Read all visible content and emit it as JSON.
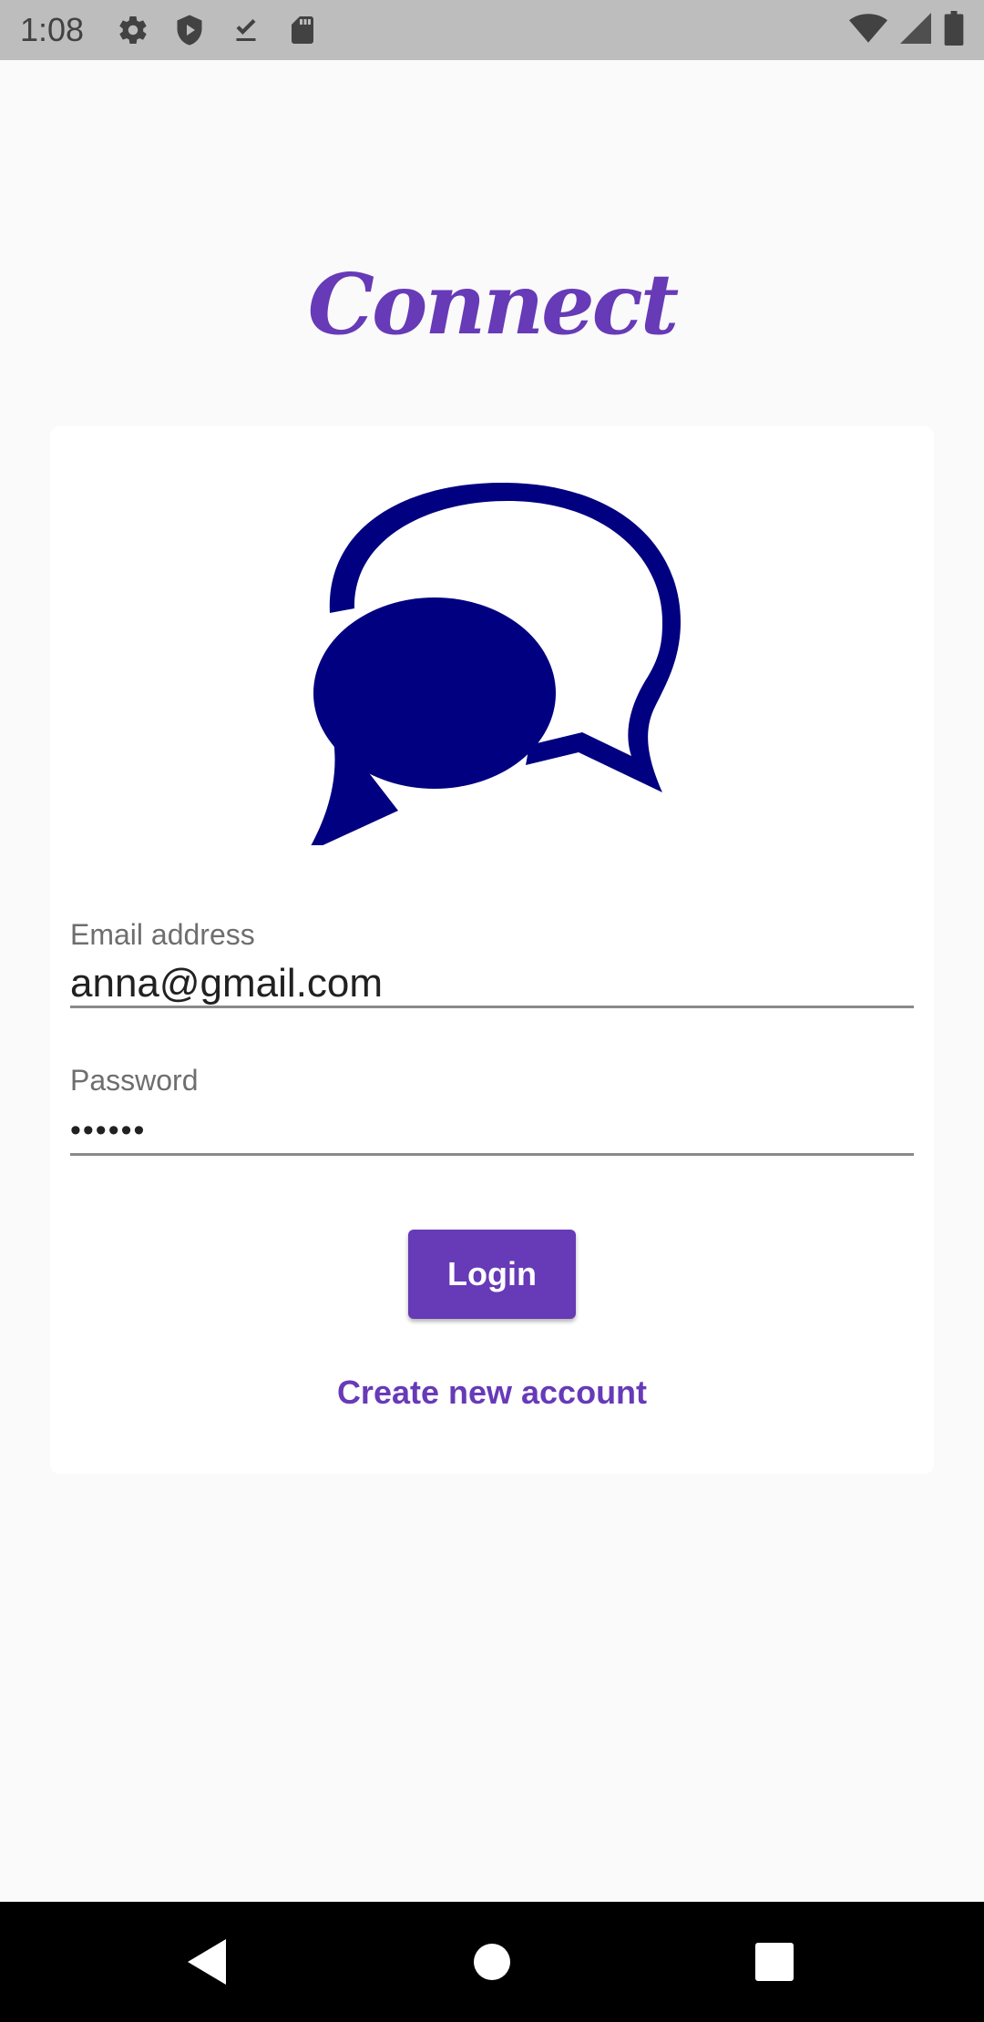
{
  "status_bar": {
    "time": "1:08",
    "icons_left": [
      "settings-icon",
      "shield-play-icon",
      "download-done-icon",
      "sd-card-icon"
    ],
    "icons_right": [
      "wifi-icon",
      "cell-signal-icon",
      "battery-icon"
    ]
  },
  "app": {
    "title": "Connect",
    "accent_color": "#673ab7",
    "logo_color": "#000080",
    "logo_icon": "chat-bubbles-icon"
  },
  "form": {
    "email": {
      "label": "Email address",
      "value": "anna@gmail.com"
    },
    "password": {
      "label": "Password",
      "value": "••••••"
    },
    "login_label": "Login",
    "create_account_label": "Create new account"
  },
  "nav_bar": {
    "buttons": [
      "back-icon",
      "home-icon",
      "recents-icon"
    ]
  }
}
